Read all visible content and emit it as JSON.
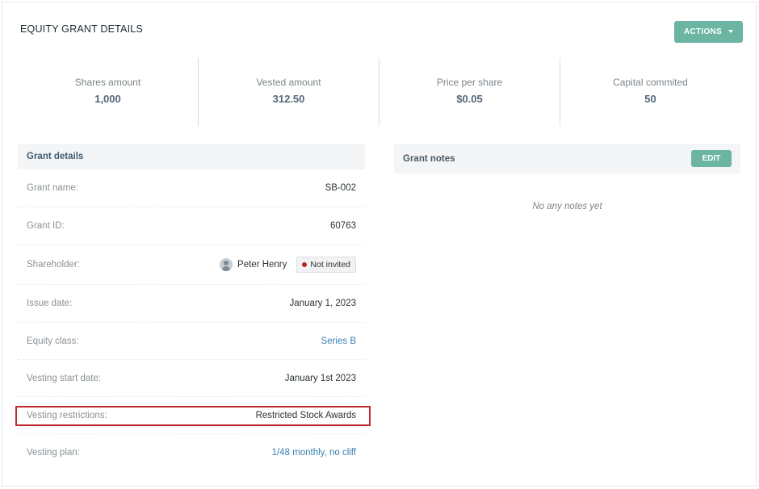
{
  "header": {
    "title": "EQUITY GRANT DETAILS",
    "actions_label": "ACTIONS"
  },
  "stats": [
    {
      "label": "Shares amount",
      "value": "1,000"
    },
    {
      "label": "Vested amount",
      "value": "312.50"
    },
    {
      "label": "Price per share",
      "value": "$0.05"
    },
    {
      "label": "Capital commited",
      "value": "50"
    }
  ],
  "details": {
    "title": "Grant details",
    "grant_name": {
      "label": "Grant name:",
      "value": "SB-002"
    },
    "grant_id": {
      "label": "Grant ID:",
      "value": "60763"
    },
    "shareholder": {
      "label": "Shareholder:",
      "name": "Peter Henry",
      "status": "Not invited",
      "status_color": "#b3261e"
    },
    "issue_date": {
      "label": "Issue date:",
      "value": "January 1, 2023"
    },
    "equity_class": {
      "label": "Equity class:",
      "value": "Series B"
    },
    "vesting_start": {
      "label": "Vesting start date:",
      "value": "January 1st 2023"
    },
    "vesting_restrictions": {
      "label": "Vesting restrictions:",
      "value": "Restricted Stock Awards"
    },
    "vesting_plan": {
      "label": "Vesting plan:",
      "value": "1/48 monthly, no cliff"
    }
  },
  "notes": {
    "title": "Grant notes",
    "edit_label": "EDIT",
    "empty_text": "No any notes yet"
  },
  "colors": {
    "accent": "#6bb5a2",
    "link": "#3a7fb3",
    "highlight": "#c0282d"
  }
}
